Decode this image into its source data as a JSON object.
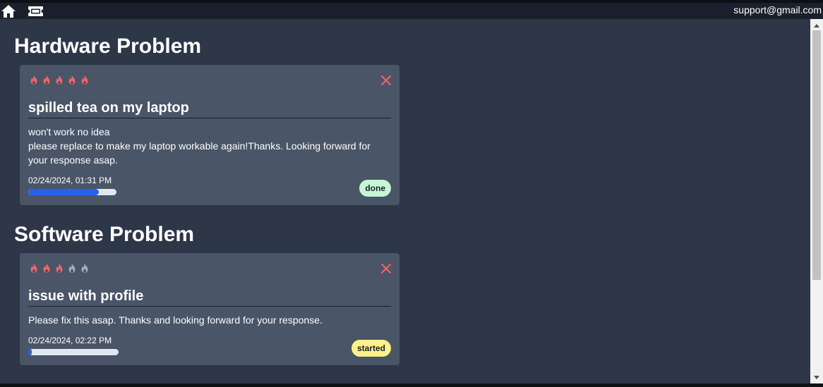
{
  "navbar": {
    "home_icon": "home-icon",
    "tickets_icon": "ticket-icon",
    "email": "support@gmail.com"
  },
  "colors": {
    "flame_active": "#f56565",
    "flame_inactive": "#a0aec0",
    "close": "#f56565",
    "progress_fill": "#2563eb",
    "badge_done": "#c6f6d5",
    "badge_started": "#fef08a"
  },
  "sections": [
    {
      "title": "Hardware Problem",
      "tickets": [
        {
          "priority": 5,
          "priority_max": 5,
          "title": "spilled tea on my laptop",
          "description": [
            "won't work no idea",
            "please replace to make my laptop workable again!Thanks. Looking forward for your response asap."
          ],
          "date": "02/24/2024, 01:31 PM",
          "progress": 0.8,
          "status": "done"
        }
      ]
    },
    {
      "title": "Software Problem",
      "tickets": [
        {
          "priority": 3,
          "priority_max": 5,
          "title": "issue with profile",
          "description": [
            "Please fix this asap. Thanks and looking forward for your response."
          ],
          "date": "02/24/2024, 02:22 PM",
          "progress": 0.04,
          "status": "started"
        }
      ]
    }
  ]
}
